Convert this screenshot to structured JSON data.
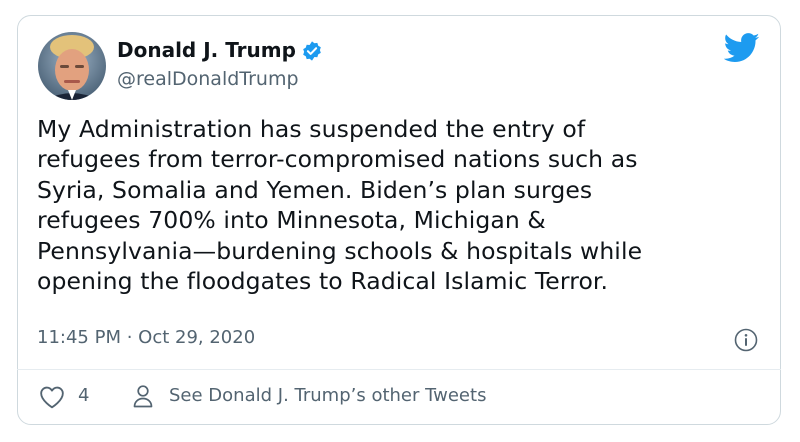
{
  "tweet": {
    "author_name": "Donald J. Trump",
    "author_handle": "@realDonaldTrump",
    "text": "My Administration has suspended the entry of\nrefugees from terror-compromised nations such as\nSyria, Somalia and Yemen. Biden’s plan surges\nrefugees 700% into Minnesota, Michigan &\nPennsylvania—burdening schools & hospitals while\nopening the floodgates to Radical Islamic Terror.",
    "timestamp": "11:45 PM · Oct 29, 2020",
    "like_count": "4",
    "see_other_label": "See Donald J. Trump’s other Tweets"
  },
  "icons": {
    "verified": "verified-badge-icon",
    "brand": "twitter-bird-icon",
    "info": "info-icon",
    "like": "heart-icon",
    "profile": "person-icon"
  },
  "colors": {
    "brand_blue": "#1d9bf0",
    "text_primary": "#0f1419",
    "text_secondary": "#536471",
    "border": "#cfd9de"
  }
}
